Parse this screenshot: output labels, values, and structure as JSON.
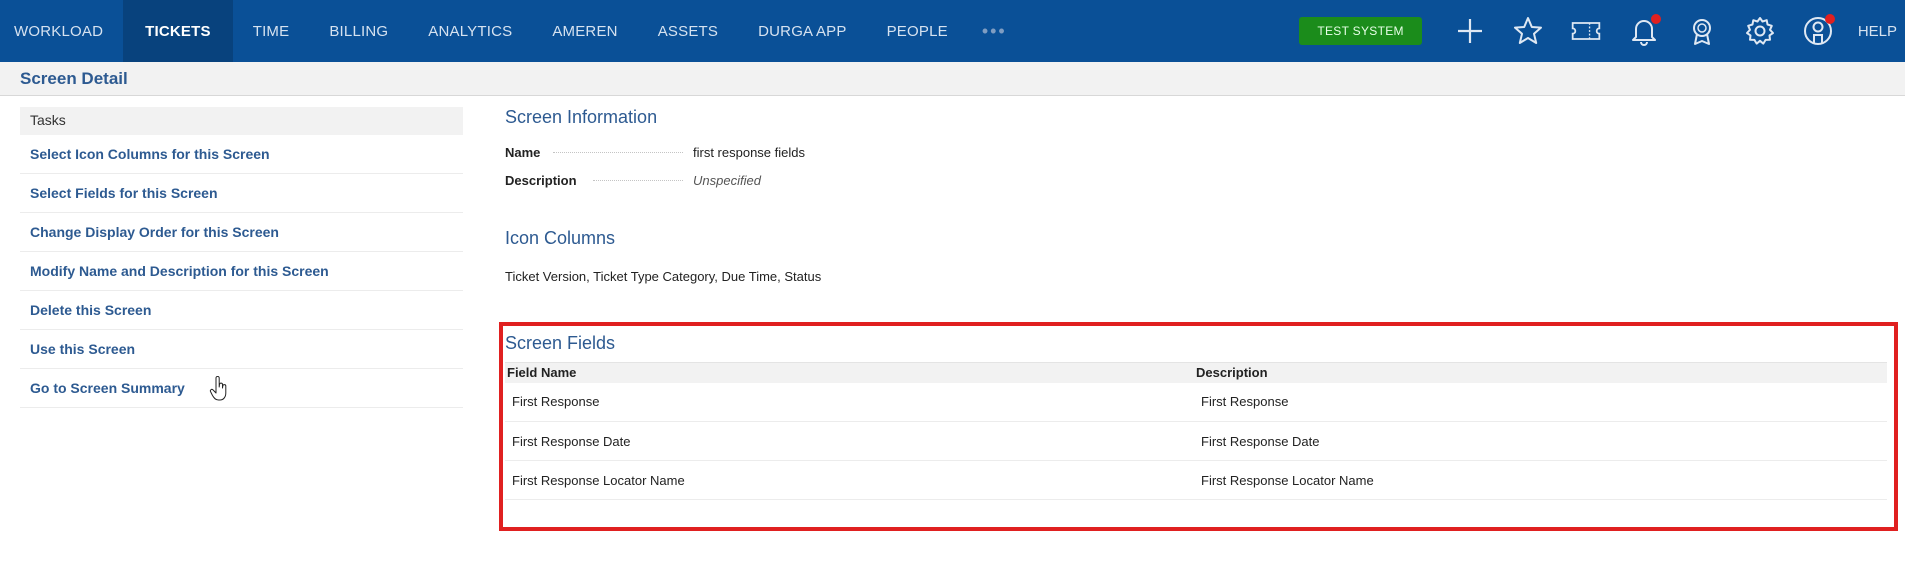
{
  "nav": {
    "items": [
      {
        "label": "WORKLOAD"
      },
      {
        "label": "TICKETS"
      },
      {
        "label": "TIME"
      },
      {
        "label": "BILLING"
      },
      {
        "label": "ANALYTICS"
      },
      {
        "label": "AMEREN"
      },
      {
        "label": "ASSETS"
      },
      {
        "label": "DURGA APP"
      },
      {
        "label": "PEOPLE"
      }
    ],
    "more": "•••",
    "active": "TICKETS",
    "badge": "TEST SYSTEM",
    "help": "HELP",
    "icons": [
      "plus-icon",
      "star-icon",
      "ticket-icon",
      "bell-icon",
      "award-icon",
      "gear-icon",
      "user-icon"
    ]
  },
  "page": {
    "title": "Screen Detail"
  },
  "sidebar": {
    "header": "Tasks",
    "links": [
      {
        "label": "Select Icon Columns for this Screen"
      },
      {
        "label": "Select Fields for this Screen"
      },
      {
        "label": "Change Display Order for this Screen"
      },
      {
        "label": "Modify Name and Description for this Screen"
      },
      {
        "label": "Delete this Screen"
      },
      {
        "label": "Use this Screen"
      },
      {
        "label": "Go to Screen Summary"
      }
    ]
  },
  "screen_info": {
    "title": "Screen Information",
    "name_label": "Name",
    "name_value": "first response fields",
    "description_label": "Description",
    "description_value": "Unspecified"
  },
  "icon_columns": {
    "title": "Icon Columns",
    "value": "Ticket Version, Ticket Type Category, Due Time, Status"
  },
  "screen_fields": {
    "title": "Screen Fields",
    "columns": [
      "Field Name",
      "Description"
    ],
    "rows": [
      {
        "field": "First Response",
        "description": "First Response"
      },
      {
        "field": "First Response Date",
        "description": "First Response Date"
      },
      {
        "field": "First Response Locator Name",
        "description": "First Response Locator Name"
      }
    ]
  },
  "colors": {
    "nav_bg": "#0a5097",
    "nav_active": "#08427d",
    "badge": "#1b8c1b",
    "link": "#2d5a91",
    "highlight": "#e02020"
  }
}
